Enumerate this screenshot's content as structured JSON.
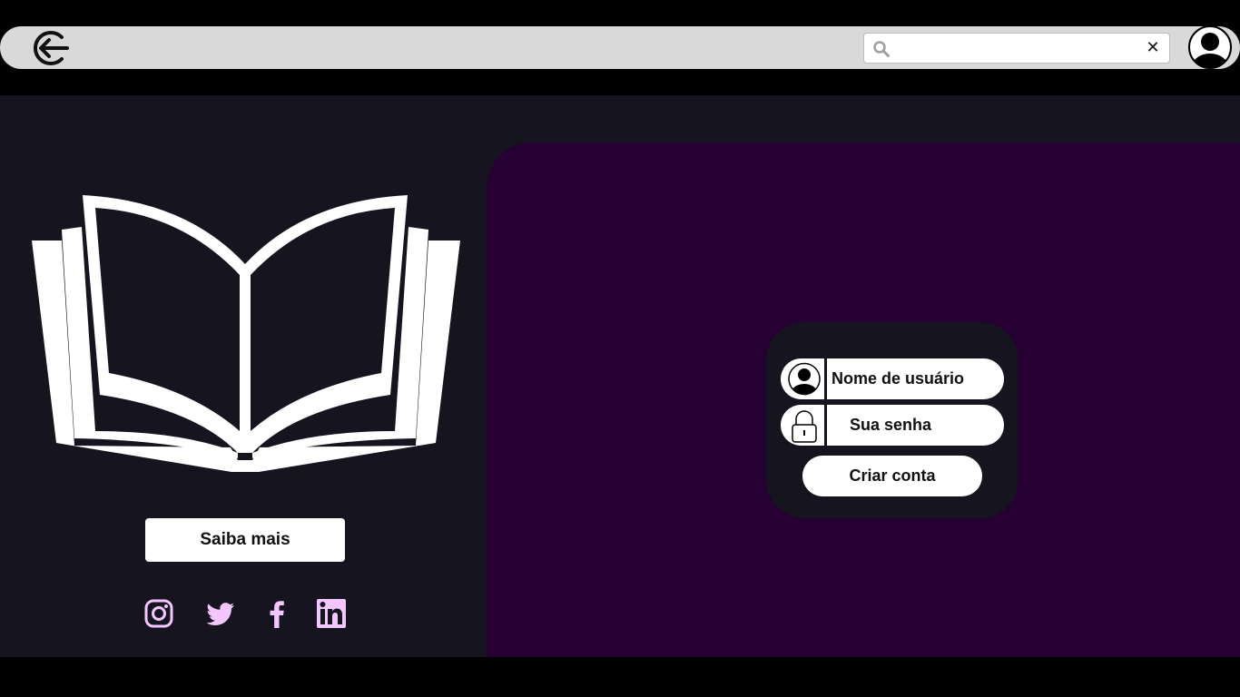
{
  "header": {
    "back_icon": "logout-arrow-icon",
    "search": {
      "placeholder": "",
      "value": "",
      "clear_label": "✕"
    },
    "avatar_icon": "user-avatar-icon"
  },
  "left": {
    "book_icon": "open-book-icon",
    "learn_more_label": "Saiba mais",
    "social": [
      "instagram-icon",
      "twitter-icon",
      "facebook-icon",
      "linkedin-icon"
    ]
  },
  "login": {
    "username_placeholder": "Nome de usuário",
    "password_placeholder": "Sua senha",
    "create_account_label": "Criar conta"
  },
  "colors": {
    "page_bg": "#16141f",
    "panel_bg": "#260033",
    "navbar_bg": "#d9d9d9",
    "social_accent": "#f3c6ff",
    "white": "#ffffff"
  }
}
